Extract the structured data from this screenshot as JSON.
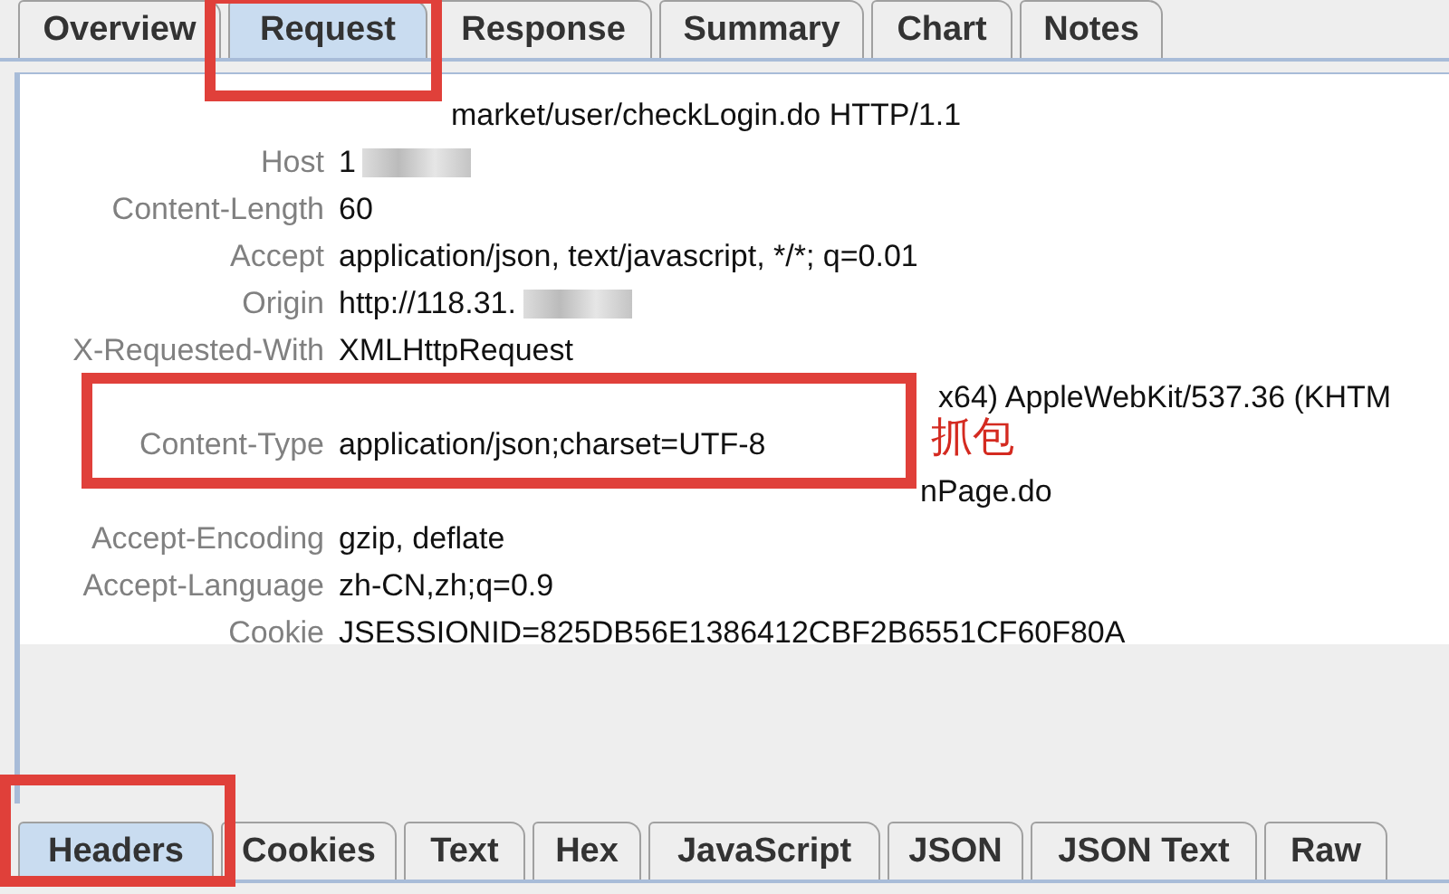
{
  "top_tabs": [
    {
      "label": "Overview",
      "selected": false
    },
    {
      "label": "Request",
      "selected": true
    },
    {
      "label": "Response",
      "selected": false
    },
    {
      "label": "Summary",
      "selected": false
    },
    {
      "label": "Chart",
      "selected": false
    },
    {
      "label": "Notes",
      "selected": false
    }
  ],
  "headers": [
    {
      "kind": "covered",
      "value": "market/user/checkLogin.do HTTP/1.1",
      "blurred": false
    },
    {
      "kind": "plain",
      "key": "Host",
      "value": "1",
      "blurred": true
    },
    {
      "kind": "plain",
      "key": "Content-Length",
      "value": "60",
      "blurred": false
    },
    {
      "kind": "plain",
      "key": "Accept",
      "value": "application/json, text/javascript, */*; q=0.01",
      "blurred": false
    },
    {
      "kind": "plain",
      "key": "Origin",
      "value": "http://118.31.",
      "blurred": true
    },
    {
      "kind": "plain",
      "key": "X-Requested-With",
      "value": "XMLHttpRequest",
      "blurred": false
    },
    {
      "kind": "covered",
      "value": "x64) AppleWebKit/537.36 (KHTM",
      "blurred": false
    },
    {
      "kind": "plain",
      "key": "Content-Type",
      "value": "application/json;charset=UTF-8",
      "blurred": false
    },
    {
      "kind": "covered",
      "value": "nPage.do",
      "blurred": false
    },
    {
      "kind": "plain",
      "key": "Accept-Encoding",
      "value": "gzip, deflate",
      "blurred": false
    },
    {
      "kind": "plain",
      "key": "Accept-Language",
      "value": "zh-CN,zh;q=0.9",
      "blurred": false
    },
    {
      "kind": "plain",
      "key": "Cookie",
      "value": "JSESSIONID=825DB56E1386412CBF2B6551CF60F80A",
      "blurred": false
    }
  ],
  "annotation": {
    "note": "抓包"
  },
  "bottom_tabs": [
    {
      "label": "Headers",
      "selected": true
    },
    {
      "label": "Cookies",
      "selected": false
    },
    {
      "label": "Text",
      "selected": false
    },
    {
      "label": "Hex",
      "selected": false
    },
    {
      "label": "JavaScript",
      "selected": false
    },
    {
      "label": "JSON",
      "selected": false
    },
    {
      "label": "JSON Text",
      "selected": false
    },
    {
      "label": "Raw",
      "selected": false
    }
  ]
}
